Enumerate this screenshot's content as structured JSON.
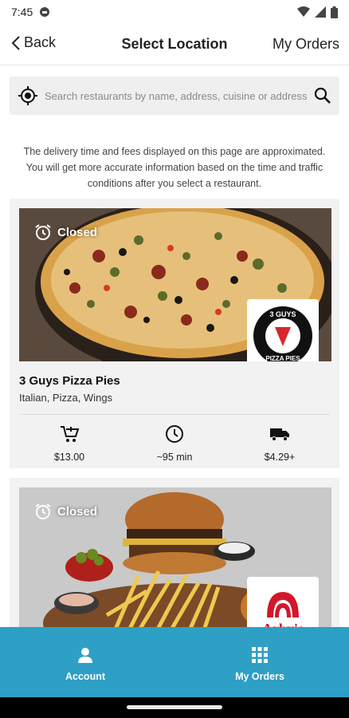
{
  "status_bar": {
    "time": "7:45"
  },
  "header": {
    "back_label": "Back",
    "title": "Select Location",
    "my_orders_label": "My Orders"
  },
  "search": {
    "placeholder": "Search restaurants by name, address, cuisine or address"
  },
  "notice": "The delivery time and fees displayed on this page are approximated. You will get more accurate information based on the time and traffic conditions after you select a restaurant.",
  "restaurants": [
    {
      "name": "3 Guys Pizza Pies",
      "cuisine": "Italian, Pizza, Wings",
      "status": "Closed",
      "logo_text": "3 GUYS PIZZA PIES",
      "min_order": "$13.00",
      "delivery_time": "~95 min",
      "delivery_fee": "$4.29+"
    },
    {
      "status": "Closed",
      "logo_text": "Arby's"
    }
  ],
  "bottom_nav": {
    "account_label": "Account",
    "my_orders_label": "My Orders"
  },
  "colors": {
    "nav_bg": "#2e9fc5",
    "card_bg": "#f2f2f2",
    "search_bg": "#efefef"
  },
  "icons": [
    "back-chevron-icon",
    "location-target-icon",
    "search-icon",
    "alarm-clock-icon",
    "cart-plus-icon",
    "clock-icon",
    "delivery-truck-icon",
    "person-icon",
    "grid-icon"
  ]
}
